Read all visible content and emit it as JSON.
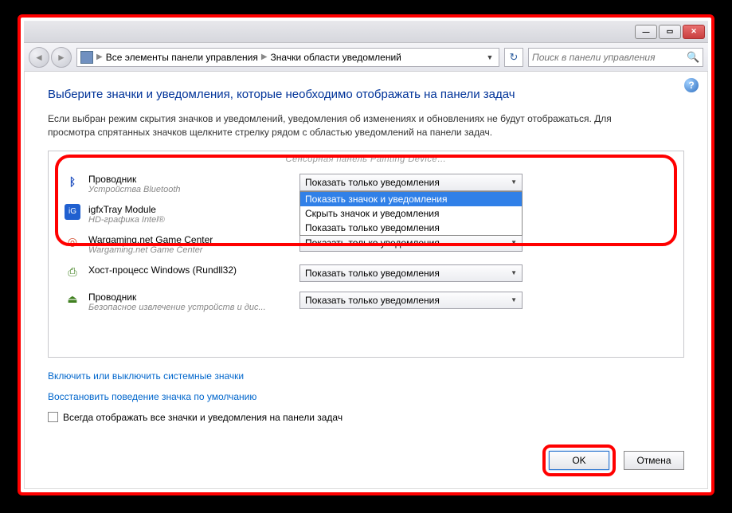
{
  "breadcrumb": {
    "item1": "Все элементы панели управления",
    "item2": "Значки области уведомлений"
  },
  "search": {
    "placeholder": "Поиск в панели управления"
  },
  "heading": "Выберите значки и уведомления, которые необходимо отображать на панели задач",
  "description": "Если выбран режим скрытия значков и уведомлений, уведомления об изменениях и обновлениях не будут отображаться. Для просмотра спрятанных значков щелкните стрелку рядом с областью уведомлений на панели задач.",
  "truncated_hint": "Сенсорная панель Painting Device…",
  "rows": [
    {
      "title": "Проводник",
      "sub": "Устройства Bluetooth",
      "value": "Показать только уведомления",
      "icon": "bt"
    },
    {
      "title": "igfxTray Module",
      "sub": "HD-графика Intel®",
      "value": "",
      "icon": "intel"
    },
    {
      "title": "Wargaming.net Game Center",
      "sub": "Wargaming.net Game Center",
      "value": "Показать только уведомления",
      "icon": "wg"
    },
    {
      "title": "Хост-процесс Windows (Rundll32)",
      "sub": "",
      "value": "Показать только уведомления",
      "icon": "usb"
    },
    {
      "title": "Проводник",
      "sub": "Безопасное извлечение устройств и дис...",
      "value": "Показать только уведомления",
      "icon": "usb"
    }
  ],
  "dropdown": {
    "opt1": "Показать значок и уведомления",
    "opt2": "Скрыть значок и уведомления",
    "opt3": "Показать только уведомления"
  },
  "link1": "Включить или выключить системные значки",
  "link2": "Восстановить поведение значка по умолчанию",
  "checkbox": "Всегда отображать все значки и уведомления на панели задач",
  "btn_ok": "OK",
  "btn_cancel": "Отмена"
}
